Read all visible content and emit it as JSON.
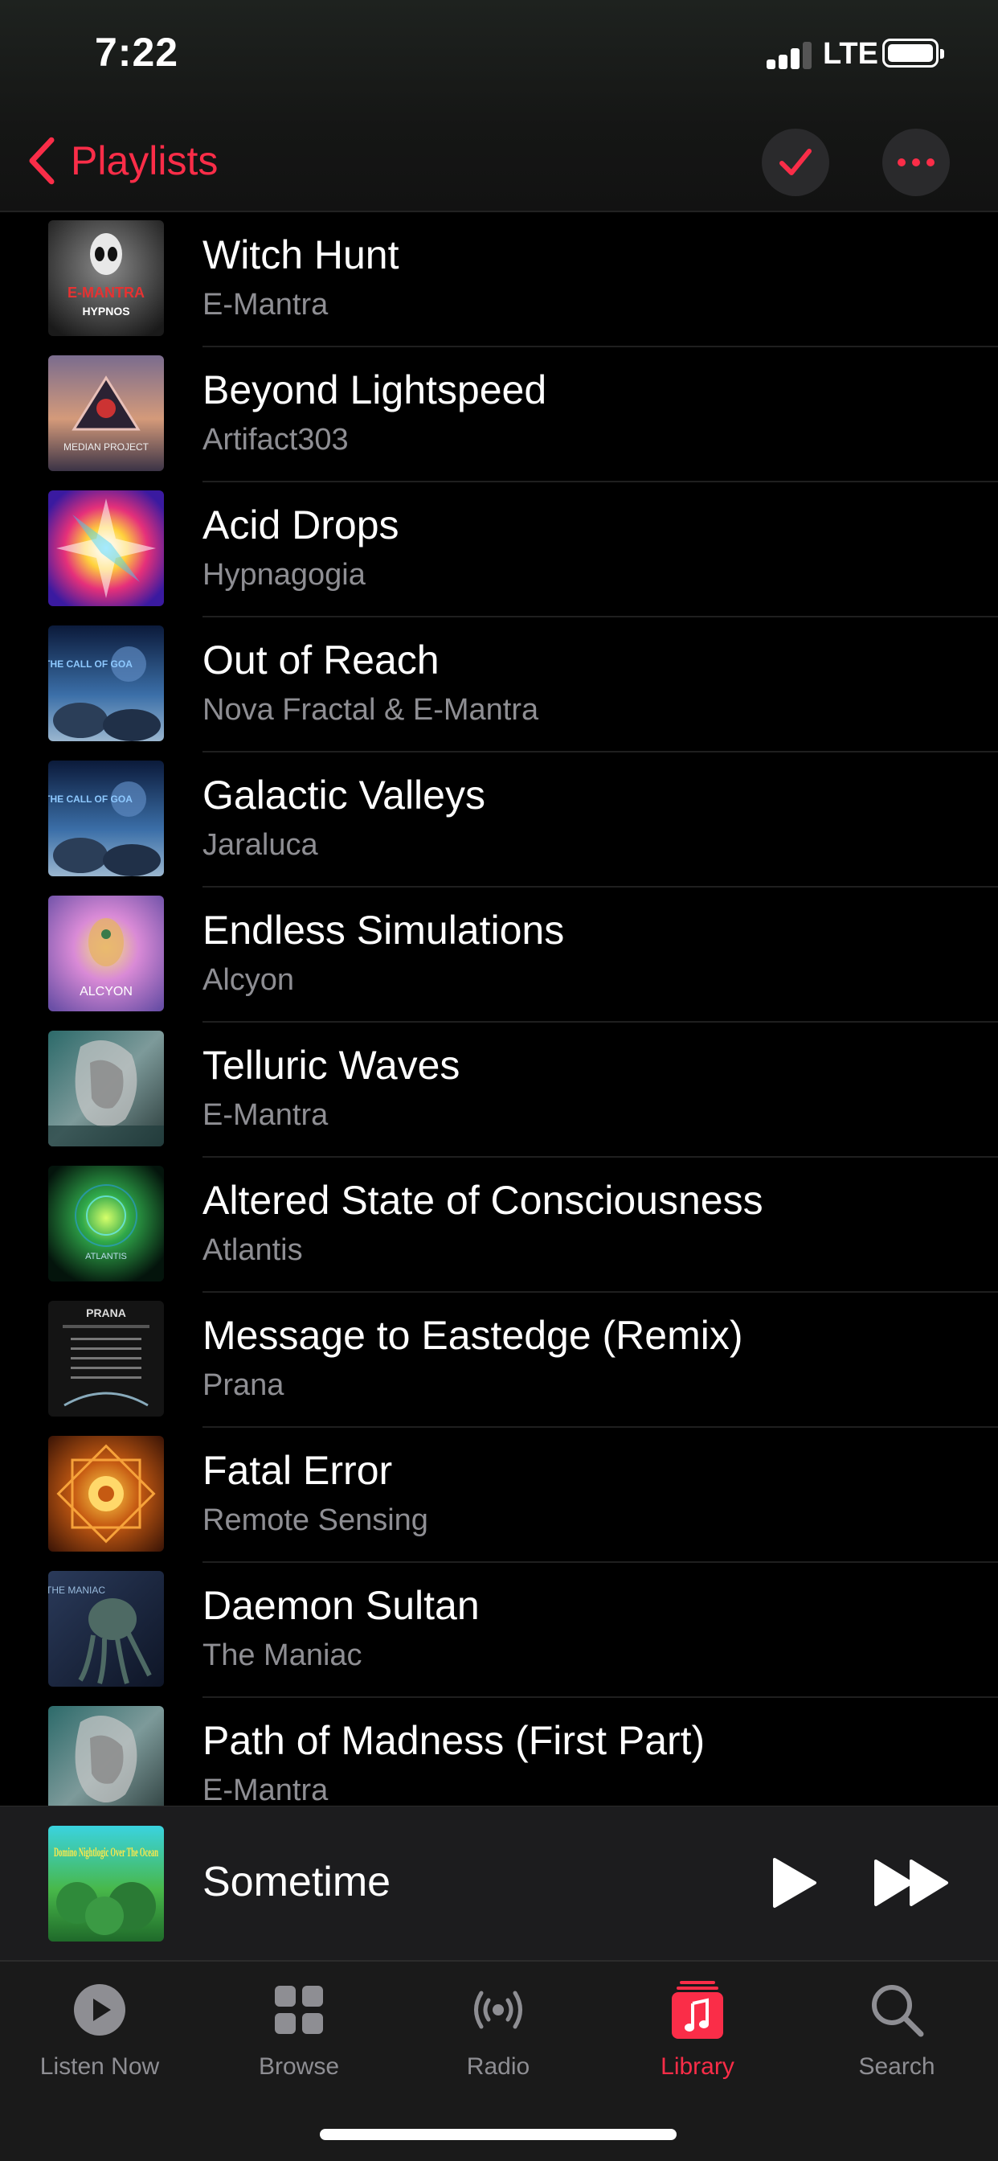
{
  "status_bar": {
    "time": "7:22",
    "network": "LTE",
    "battery_level": 0.95
  },
  "nav": {
    "back_label": "Playlists",
    "back_icon": "chevron-left-icon",
    "select_icon": "checkmark-icon",
    "more_icon": "ellipsis-icon"
  },
  "songs": [
    {
      "title": "Witch Hunt",
      "artist": "E-Mantra"
    },
    {
      "title": "Beyond Lightspeed",
      "artist": "Artifact303"
    },
    {
      "title": "Acid Drops",
      "artist": "Hypnagogia"
    },
    {
      "title": "Out of Reach",
      "artist": "Nova Fractal & E-Mantra"
    },
    {
      "title": "Galactic Valleys",
      "artist": "Jaraluca"
    },
    {
      "title": "Endless Simulations",
      "artist": "Alcyon"
    },
    {
      "title": "Telluric Waves",
      "artist": "E-Mantra"
    },
    {
      "title": "Altered State of Consciousness",
      "artist": "Atlantis"
    },
    {
      "title": "Message to Eastedge (Remix)",
      "artist": "Prana"
    },
    {
      "title": "Fatal Error",
      "artist": "Remote Sensing"
    },
    {
      "title": "Daemon Sultan",
      "artist": "The Maniac"
    },
    {
      "title": "Path of Madness (First Part)",
      "artist": "E-Mantra"
    }
  ],
  "artwork_text": {
    "witch_hunt": "E-MANTRA",
    "witch_hunt_sub": "HYPNOS",
    "beyond_lightspeed": "MEDIAN PROJECT",
    "out_of_reach": "THE CALL OF GOA",
    "galactic_valleys": "THE CALL OF GOA",
    "endless_simulations": "ALCYON",
    "altered_state": "ATLANTIS",
    "message_to_eastedge": "PRANA",
    "daemon_sultan": "THE MANIAC"
  },
  "now_playing": {
    "title": "Sometime",
    "artwork_text": "Domino Nightlogic Over The Ocean",
    "play_icon": "play-icon",
    "forward_icon": "fast-forward-icon"
  },
  "tabs": [
    {
      "label": "Listen Now",
      "icon": "play-circle-icon",
      "active": false
    },
    {
      "label": "Browse",
      "icon": "grid-icon",
      "active": false
    },
    {
      "label": "Radio",
      "icon": "radio-waves-icon",
      "active": false
    },
    {
      "label": "Library",
      "icon": "music-note-icon",
      "active": true
    },
    {
      "label": "Search",
      "icon": "magnifier-icon",
      "active": false
    }
  ],
  "colors": {
    "accent": "#fa2d48",
    "background": "#000000",
    "secondary_text": "#8e8e93"
  }
}
